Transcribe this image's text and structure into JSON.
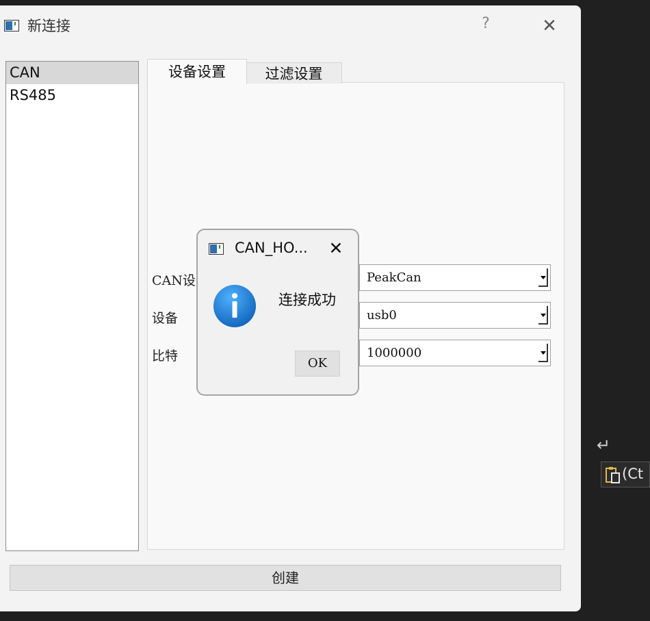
{
  "main_window": {
    "title": "新连接",
    "help_label": "?",
    "close_label": "✕"
  },
  "connection_types": [
    {
      "label": "CAN",
      "selected": true
    },
    {
      "label": "RS485",
      "selected": false
    }
  ],
  "tabs": [
    {
      "label": "设备设置",
      "active": true
    },
    {
      "label": "过滤设置",
      "active": false
    }
  ],
  "form": {
    "can_device_label": "CAN设",
    "device_label": "设备",
    "bitrate_label": "比特",
    "can_device_value": "PeakCan",
    "device_value": "usb0",
    "bitrate_value": "1000000"
  },
  "create_button": "创建",
  "message_box": {
    "title": "CAN_HO...",
    "close_label": "✕",
    "message": "连接成功",
    "ok_label": "OK",
    "icon": "info-icon"
  },
  "side_overlay": {
    "enter_glyph": "↵",
    "paste_text": "(Ct",
    "icon": "paste-icon"
  },
  "colors": {
    "info_blue": "#1a7fd8",
    "window_bg": "#f3f3f3",
    "desktop_bg": "#202020"
  }
}
